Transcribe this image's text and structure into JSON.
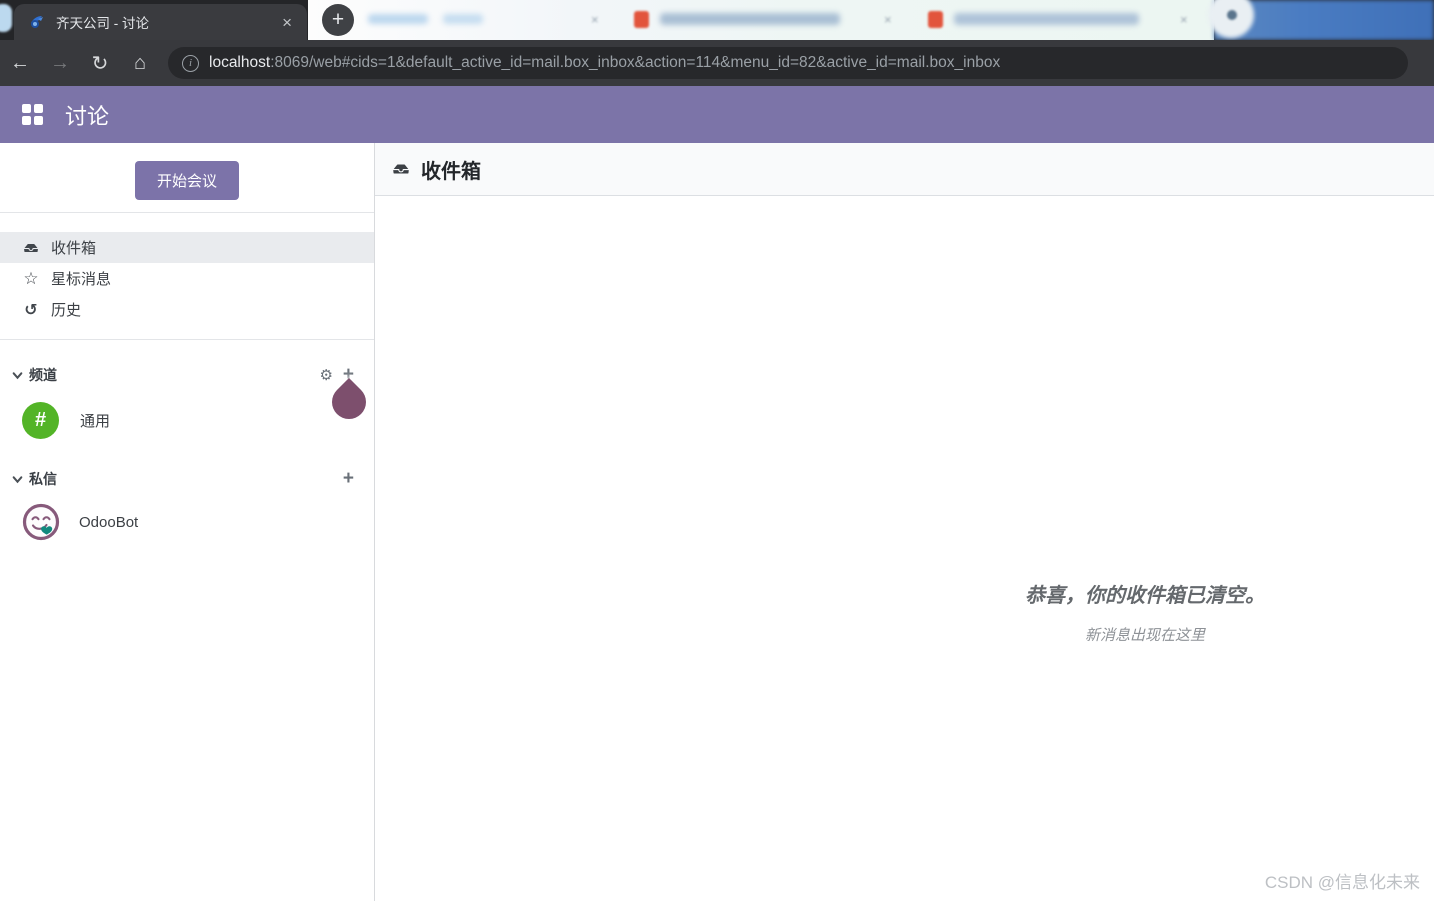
{
  "browser": {
    "tab_title": "齐天公司 - 讨论",
    "url_host": "localhost",
    "url_rest": ":8069/web#cids=1&default_active_id=mail.box_inbox&action=114&menu_id=82&active_id=mail.box_inbox"
  },
  "icons": {
    "close": "×",
    "new_tab": "+",
    "back": "←",
    "forward": "→",
    "reload": "↻",
    "home": "⌂",
    "info": "i",
    "star": "☆",
    "history": "↺",
    "gear": "⚙",
    "plus": "+",
    "hash": "#"
  },
  "app_header": {
    "title": "讨论"
  },
  "sidebar": {
    "start_meeting_label": "开始会议",
    "mailboxes": [
      {
        "label": "收件箱",
        "active": true
      },
      {
        "label": "星标消息",
        "active": false
      },
      {
        "label": "历史",
        "active": false
      }
    ],
    "channels_section": {
      "label": "频道",
      "items": [
        {
          "label": "通用"
        }
      ]
    },
    "dm_section": {
      "label": "私信",
      "items": [
        {
          "label": "OdooBot"
        }
      ]
    }
  },
  "main": {
    "header_title": "收件箱",
    "empty_title": "恭喜，你的收件箱已清空。",
    "empty_subtitle": "新消息出现在这里"
  },
  "watermark": "CSDN @信息化未来",
  "colors": {
    "header_purple": "#7c74a8",
    "button_purple": "#7c73a9",
    "channel_green": "#53b427",
    "odoobot_purple": "#875a7b",
    "odoobot_teal": "#12897e",
    "cursor_plum": "#7d4f6d"
  }
}
